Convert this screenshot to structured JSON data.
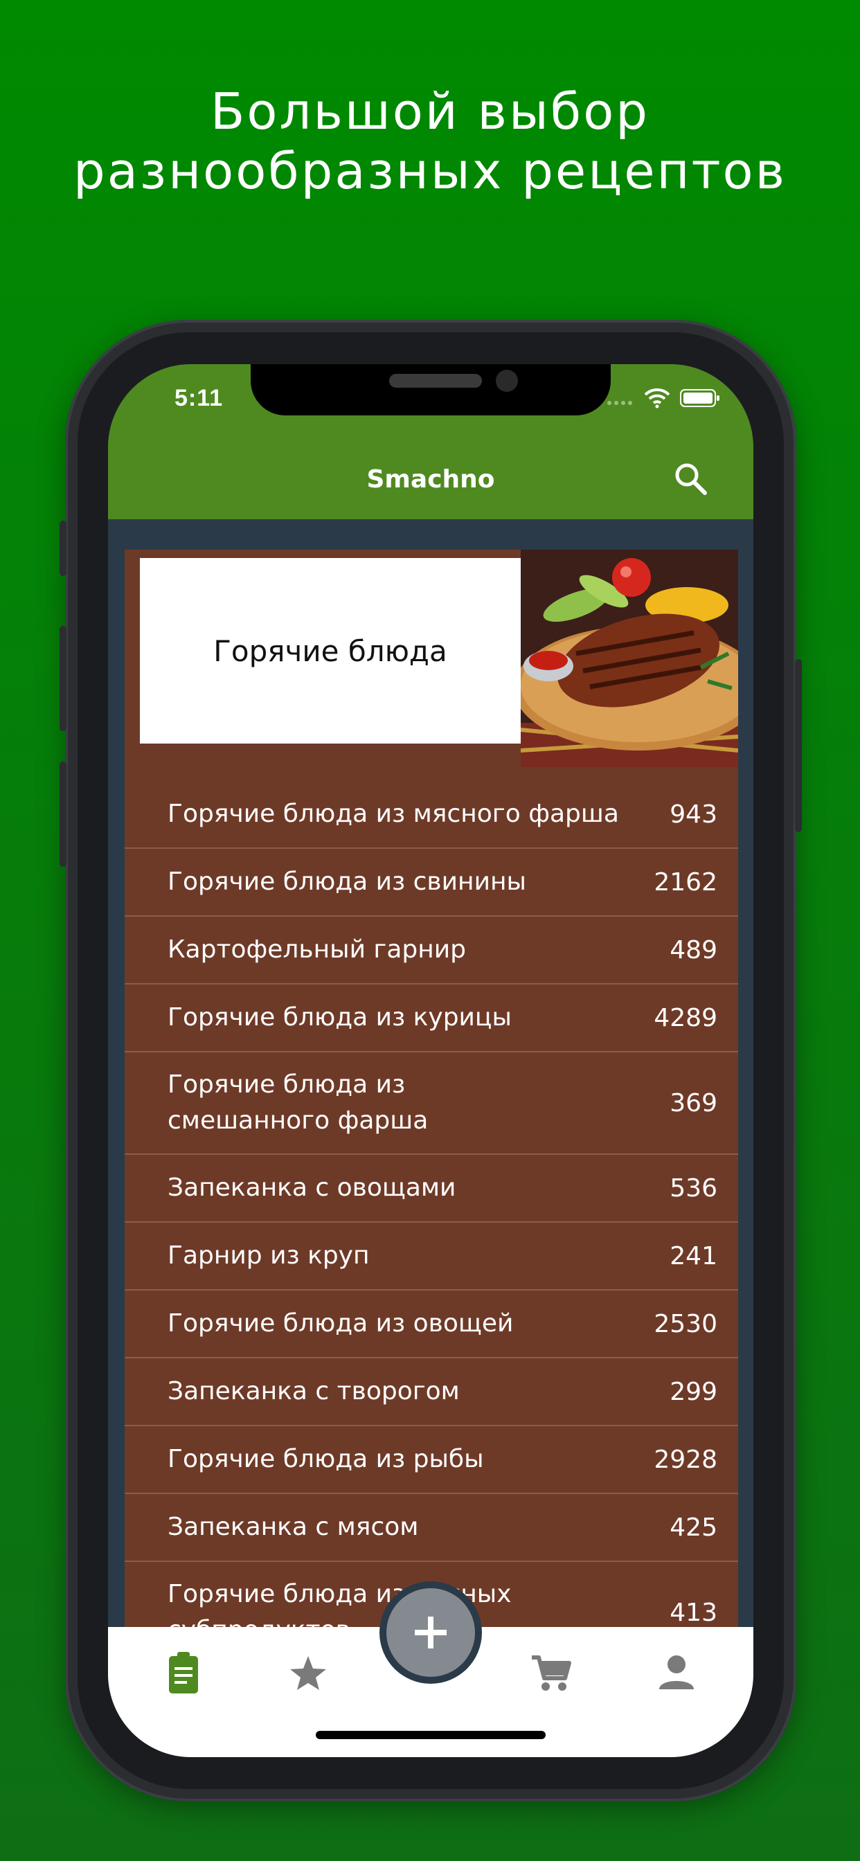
{
  "promo": {
    "line1": "Большой выбор",
    "line2": "разнообразных рецептов"
  },
  "status_bar": {
    "time": "5:11"
  },
  "app_bar": {
    "title": "Smachno",
    "search_icon": "search-icon"
  },
  "category": {
    "title": "Горячие блюда",
    "image": "grilled-steak-photo"
  },
  "recipes": [
    {
      "label": "Горячие блюда из мясного фарша",
      "count": "943"
    },
    {
      "label": "Горячие блюда из свинины",
      "count": "2162"
    },
    {
      "label": "Картофельный гарнир",
      "count": "489"
    },
    {
      "label": "Горячие блюда из курицы",
      "count": "4289"
    },
    {
      "label": "Горячие блюда из\nсмешанного фарша",
      "count": "369"
    },
    {
      "label": "Запеканка с овощами",
      "count": "536"
    },
    {
      "label": "Гарнир из круп",
      "count": "241"
    },
    {
      "label": "Горячие блюда из овощей",
      "count": "2530"
    },
    {
      "label": "Запеканка с творогом",
      "count": "299"
    },
    {
      "label": "Горячие блюда из рыбы",
      "count": "2928"
    },
    {
      "label": "Запеканка с мясом",
      "count": "425"
    },
    {
      "label": "Горячие блюда из мясных\nсубпродуктов",
      "count": "413"
    }
  ],
  "tab_bar": {
    "items": [
      "recipes-clipboard-icon",
      "favorites-star-icon",
      "add-icon",
      "cart-icon",
      "profile-icon"
    ],
    "active": "recipes-clipboard-icon"
  },
  "colors": {
    "background": "#008a00",
    "app_bar": "#4f8a21",
    "list_bg": "#6e3a28",
    "active_tab": "#4f8a21",
    "inactive_tab": "#7a7a7a"
  }
}
